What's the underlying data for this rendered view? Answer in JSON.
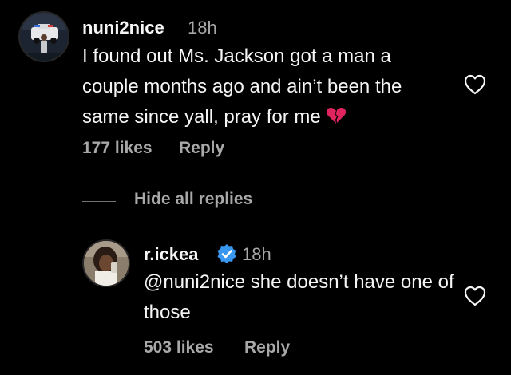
{
  "comment": {
    "username": "nuni2nice",
    "time": "18h",
    "text": "I found out Ms. Jackson got a man a couple months ago and ain’t been the same since yall, pray for me",
    "emoji": "broken-heart-icon",
    "likes": "177 likes",
    "reply_label": "Reply"
  },
  "replies_toggle": "Hide all replies",
  "reply": {
    "username": "r.ickea",
    "verified": true,
    "time": "18h",
    "text": "@nuni2nice she doesn’t have one of those",
    "likes": "503 likes",
    "reply_label": "Reply"
  },
  "colors": {
    "background": "#000000",
    "text": "#f5f5f5",
    "secondary_text": "#a8a8a8",
    "verified_blue": "#3897f0",
    "broken_heart": "#e0245e"
  }
}
